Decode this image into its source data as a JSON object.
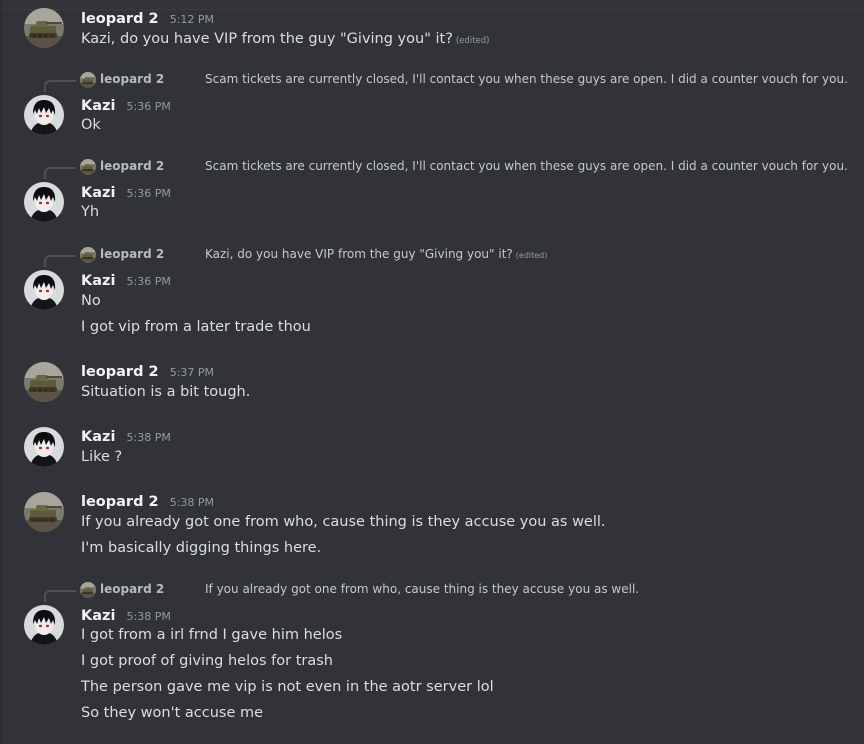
{
  "messages": {
    "m1": {
      "author": "leopard 2",
      "time": "5:12 PM",
      "lines": [
        "Kazi, do you have VIP from the guy \"Giving you\" it?"
      ],
      "edited": "(edited)"
    },
    "m2": {
      "reply": {
        "author": "leopard 2",
        "text": "Scam tickets are currently closed, I'll contact you when these guys are open. I did a counter vouch for you."
      },
      "author": "Kazi",
      "time": "5:36 PM",
      "lines": [
        "Ok"
      ]
    },
    "m3": {
      "reply": {
        "author": "leopard 2",
        "text": "Scam tickets are currently closed, I'll contact you when these guys are open. I did a counter vouch for you."
      },
      "author": "Kazi",
      "time": "5:36 PM",
      "lines": [
        "Yh"
      ]
    },
    "m4": {
      "reply": {
        "author": "leopard 2",
        "text": "Kazi, do you have VIP from the guy \"Giving you\" it?",
        "edited": "(edited)"
      },
      "author": "Kazi",
      "time": "5:36 PM",
      "lines": [
        "No",
        "I got  vip from a later trade thou"
      ]
    },
    "m5": {
      "author": "leopard 2",
      "time": "5:37 PM",
      "lines": [
        "Situation is a bit tough."
      ]
    },
    "m6": {
      "author": "Kazi",
      "time": "5:38 PM",
      "lines": [
        "Like ?"
      ]
    },
    "m7": {
      "author": "leopard 2",
      "time": "5:38 PM",
      "lines": [
        "If you already got one from who, cause thing is they accuse you as well.",
        "I'm basically digging things here."
      ]
    },
    "m8": {
      "reply": {
        "author": "leopard 2",
        "text": "If you already got one from who, cause thing is they accuse you as well."
      },
      "author": "Kazi",
      "time": "5:38 PM",
      "lines": [
        "I got from a irl frnd I gave him helos",
        "I got proof of giving helos for trash",
        "The person gave me vip is not even in the aotr server lol",
        "So they won't accuse me"
      ]
    }
  },
  "icons": {
    "leopard_avatar": "tank-avatar-icon",
    "kazi_avatar": "anime-avatar-icon",
    "reply_spine": "reply-connector-icon"
  },
  "colors": {
    "background": "#313338",
    "username": "#f2f3f5",
    "message_text": "#dbdee1",
    "timestamp": "#949ba4"
  }
}
